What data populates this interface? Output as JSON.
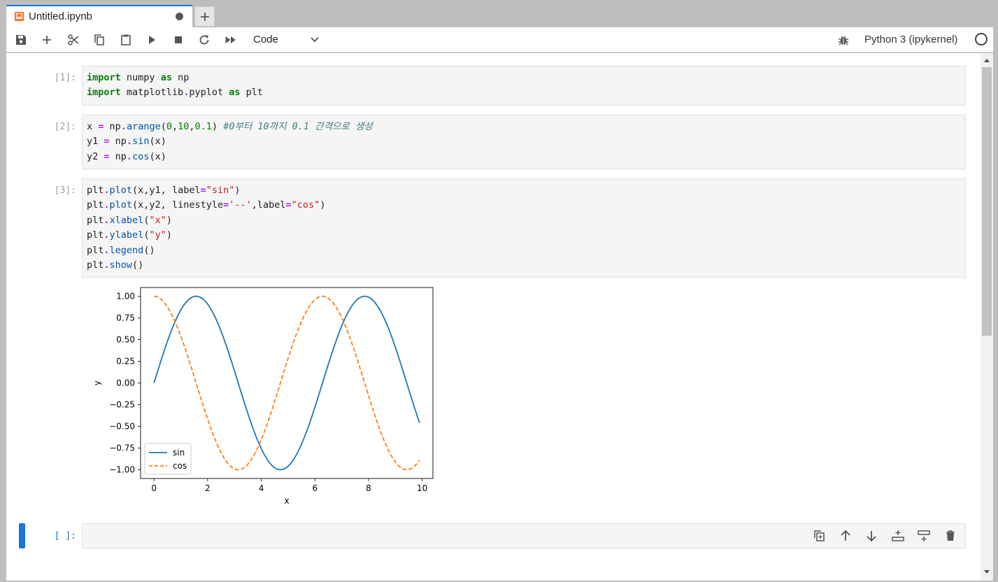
{
  "tab": {
    "title": "Untitled.ipynb",
    "icon": "notebook-icon",
    "new_tab_label": "+"
  },
  "toolbar": {
    "buttons": [
      "save-icon",
      "plus-icon",
      "cut-icon",
      "copy-icon",
      "paste-icon",
      "run-icon",
      "stop-icon",
      "restart-icon",
      "fast-forward-icon"
    ],
    "cell_type": "Code",
    "kernel_name": "Python 3 (ipykernel)"
  },
  "cells": [
    {
      "prompt": "[1]:",
      "lines": [
        "import numpy as np",
        "import matplotlib.pyplot as plt"
      ]
    },
    {
      "prompt": "[2]:",
      "lines": [
        "x = np.arange(0,10,0.1) #0부터 10까지 0.1 간격으로 생성",
        "y1 = np.sin(x)",
        "y2 = np.cos(x)"
      ]
    },
    {
      "prompt": "[3]:",
      "lines": [
        "plt.plot(x,y1, label=\"sin\")",
        "plt.plot(x,y2, linestyle='--',label=\"cos\")",
        "plt.xlabel(\"x\")",
        "plt.ylabel(\"y\")",
        "plt.legend()",
        "plt.show()"
      ]
    },
    {
      "prompt": "[ ]:",
      "lines": []
    }
  ],
  "chart_data": {
    "type": "line",
    "xlabel": "x",
    "ylabel": "y",
    "xlim": [
      -0.5,
      10.4
    ],
    "ylim": [
      -1.1,
      1.1
    ],
    "xticks": [
      0,
      2,
      4,
      6,
      8,
      10
    ],
    "yticks": [
      -1.0,
      -0.75,
      -0.5,
      -0.25,
      0.0,
      0.25,
      0.5,
      0.75,
      1.0
    ],
    "xtick_labels": [
      "0",
      "2",
      "4",
      "6",
      "8",
      "10"
    ],
    "ytick_labels": [
      "−1.00",
      "−0.75",
      "−0.50",
      "−0.25",
      "0.00",
      "0.25",
      "0.50",
      "0.75",
      "1.00"
    ],
    "x": {
      "start": 0,
      "stop": 10,
      "step": 0.1
    },
    "series": [
      {
        "name": "sin",
        "function": "sin",
        "color": "#1f77b4",
        "linestyle": "solid"
      },
      {
        "name": "cos",
        "function": "cos",
        "color": "#ff7f0e",
        "linestyle": "dashed"
      }
    ],
    "legend": "lower-left",
    "grid": false
  },
  "colors": {
    "accent": "#1976d2",
    "code_bg": "#f5f5f5"
  }
}
